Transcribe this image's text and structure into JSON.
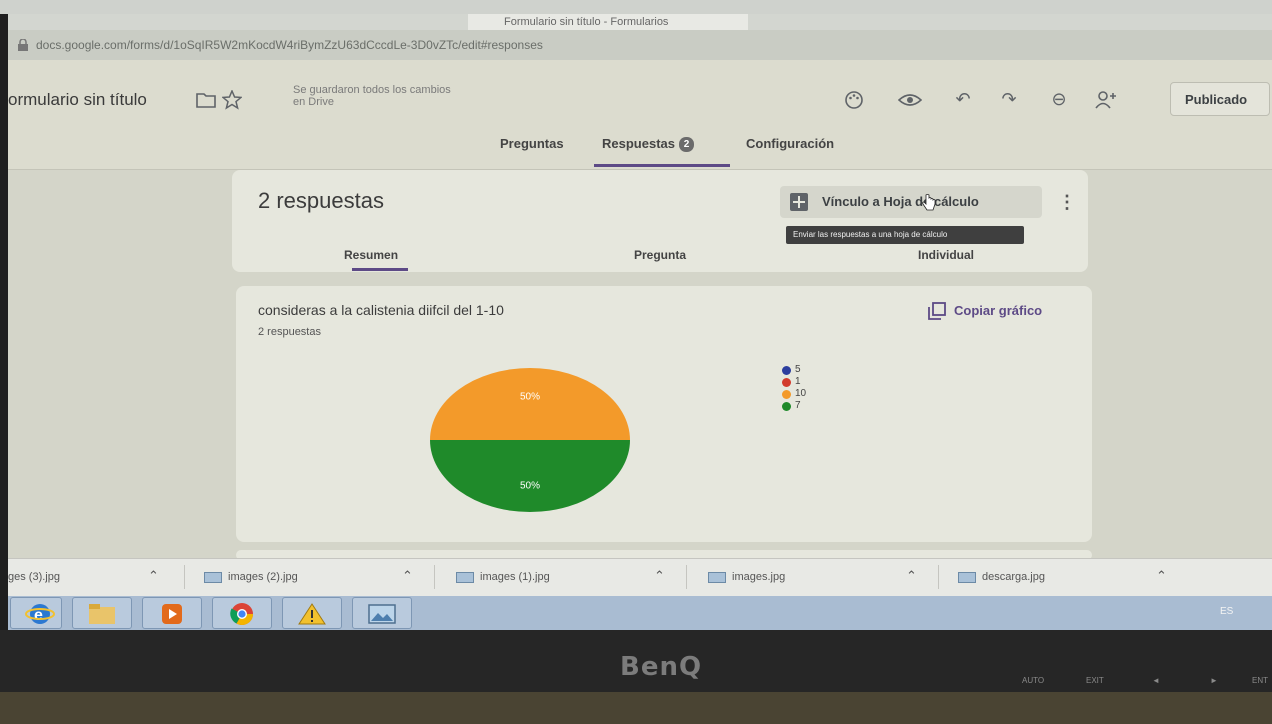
{
  "browser": {
    "tab_title": "Formulario sin título - Formularios",
    "url": "docs.google.com/forms/d/1oSqIR5W2mKocdW4riBymZzU63dCccdLe-3D0vZTc/edit#responses"
  },
  "header": {
    "form_title": "ormulario sin título",
    "save_status": "Se guardaron todos los cambios en Drive",
    "publish_label": "Publicado",
    "icons": [
      "palette-icon",
      "preview-eye-icon",
      "undo-icon",
      "redo-icon",
      "link-icon",
      "add-collaborator-icon"
    ]
  },
  "tabs": {
    "questions": "Preguntas",
    "responses": "Respuestas",
    "responses_badge": "2",
    "settings": "Configuración"
  },
  "summary_card": {
    "count_label": "2 respuestas",
    "sheets_button": "Vínculo a Hoja de cálculo",
    "tooltip": "Enviar las respuestas a una hoja de cálculo",
    "more_icon": "⋮",
    "subtabs": {
      "summary": "Resumen",
      "question": "Pregunta",
      "individual": "Individual"
    }
  },
  "question_card": {
    "title": "consideras a la calistenia diifcil del 1-10",
    "count": "2 respuestas",
    "copy_button": "Copiar gráfico"
  },
  "chart_data": {
    "type": "pie",
    "labels": [
      "5",
      "1",
      "10",
      "7"
    ],
    "values": [
      0,
      0,
      1,
      1
    ],
    "percent_labels": [
      "50%",
      "50%"
    ],
    "colors": [
      "#2c3e9e",
      "#d23b2c",
      "#f39a2a",
      "#1f8a2a"
    ],
    "legend_position": "right"
  },
  "downloads": [
    {
      "name": "ges (3).jpg"
    },
    {
      "name": "images (2).jpg"
    },
    {
      "name": "images (1).jpg"
    },
    {
      "name": "images.jpg"
    },
    {
      "name": "descarga.jpg"
    }
  ],
  "taskbar": {
    "apps": [
      "internet-explorer-icon",
      "file-explorer-icon",
      "media-player-icon",
      "chrome-icon",
      "warning-icon",
      "photo-viewer-icon"
    ],
    "language": "ES"
  },
  "monitor": {
    "brand": "BenQ",
    "buttons": [
      "AUTO",
      "EXIT",
      "◄",
      "►",
      "ENT"
    ]
  },
  "colors": {
    "accent": "#5d4a86",
    "screen_bg": "#d9dad2",
    "taskbar": "#a9bcd2"
  }
}
